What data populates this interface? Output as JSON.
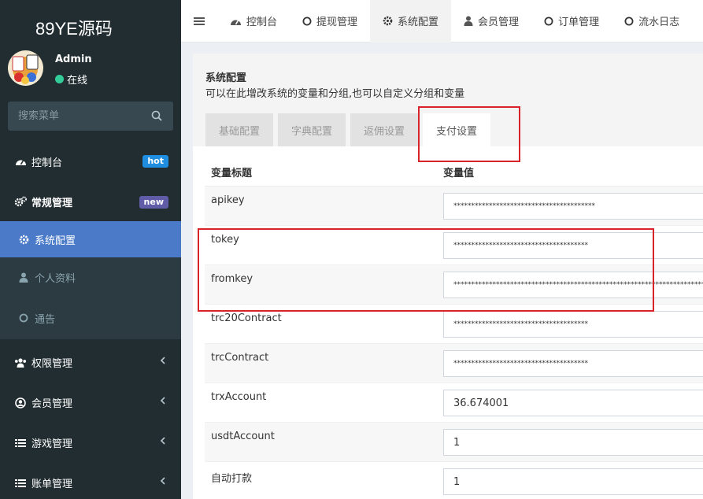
{
  "brand": "89YE源码",
  "user": {
    "name": "Admin",
    "status": "在线"
  },
  "search": {
    "placeholder": "搜索菜单"
  },
  "menu": [
    {
      "label": "控制台",
      "icon": "dashboard-icon",
      "badge": "hot"
    },
    {
      "label": "常规管理",
      "icon": "cogs-icon",
      "badge": "new"
    },
    {
      "label": "系统配置",
      "icon": "gear-icon"
    },
    {
      "label": "个人资料",
      "icon": "user-icon"
    },
    {
      "label": "通告",
      "icon": "circle-icon"
    },
    {
      "label": "权限管理",
      "icon": "group-icon"
    },
    {
      "label": "会员管理",
      "icon": "user-circle-icon"
    },
    {
      "label": "游戏管理",
      "icon": "list-icon"
    },
    {
      "label": "账单管理",
      "icon": "list-icon"
    }
  ],
  "topnav": {
    "tabs": [
      {
        "label": "控制台",
        "icon": "dashboard-icon"
      },
      {
        "label": "提现管理",
        "icon": "circle-icon"
      },
      {
        "label": "系统配置",
        "icon": "gear-icon"
      },
      {
        "label": "会员管理",
        "icon": "user-icon"
      },
      {
        "label": "订单管理",
        "icon": "circle-icon"
      },
      {
        "label": "流水日志",
        "icon": "circle-icon"
      }
    ]
  },
  "panel": {
    "title": "系统配置",
    "desc": "可以在此增改系统的变量和分组,也可以自定义分组和变量",
    "subtabs": [
      "基础配置",
      "字典配置",
      "返佣设置",
      "支付设置"
    ]
  },
  "table": {
    "headers": [
      "变量标题",
      "变量值"
    ],
    "rows": [
      {
        "key": "apikey",
        "value": "****************************************"
      },
      {
        "key": "tokey",
        "value": "**************************************"
      },
      {
        "key": "fromkey",
        "value": "**************************************************************************"
      },
      {
        "key": "trc20Contract",
        "value": "**************************************"
      },
      {
        "key": "trcContract",
        "value": "**************************************"
      },
      {
        "key": "trxAccount",
        "value": "36.674001"
      },
      {
        "key": "usdtAccount",
        "value": "1"
      },
      {
        "key": "自动打款",
        "value": "1"
      }
    ]
  },
  "colors": {
    "sidebar": "#222d32",
    "active_menu": "#4a7ac8",
    "highlight": "#d9222a"
  }
}
